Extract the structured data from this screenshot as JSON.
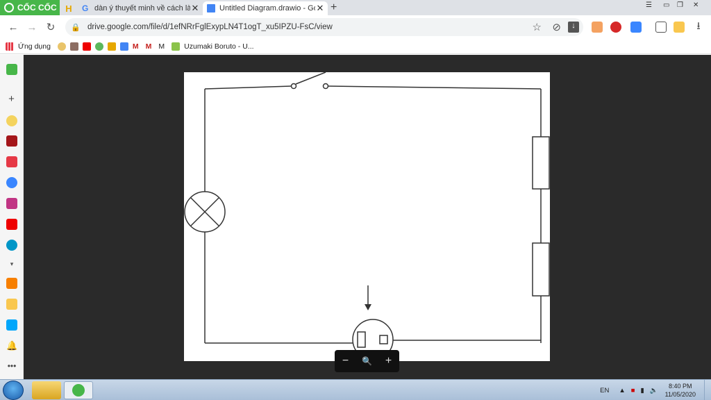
{
  "browser": {
    "brand": "CỐC CỐC",
    "tabs": [
      {
        "title": "dàn ý thuyết minh về cách làm",
        "favicon": "google-icon",
        "active": false
      },
      {
        "title": "Untitled Diagram.drawio - Go",
        "favicon": "google-docs-icon",
        "active": true
      }
    ],
    "url": "drive.google.com/file/d/1efNRrFglExypLN4T1ogT_xu5IPZU-FsC/view",
    "bookmarks": [
      {
        "label": "Ứng dụng",
        "icon": "apps-grid-icon"
      },
      {
        "label": "",
        "icon": "bookmark-1-icon"
      },
      {
        "label": "",
        "icon": "bookmark-2-icon"
      },
      {
        "label": "",
        "icon": "youtube-icon"
      },
      {
        "label": "",
        "icon": "bookmark-4-icon"
      },
      {
        "label": "",
        "icon": "h-icon"
      },
      {
        "label": "",
        "icon": "translate-icon"
      },
      {
        "label": "M",
        "icon": "gmail-icon"
      },
      {
        "label": "M",
        "icon": "gmail-icon-2"
      },
      {
        "label": "M",
        "icon": ""
      },
      {
        "label": "Uzumaki Boruto - U...",
        "icon": "image-icon"
      }
    ]
  },
  "viewer": {
    "zoom_controls": {
      "zoom_out": "−",
      "zoom": "🔍",
      "zoom_in": "+"
    }
  },
  "taskbar": {
    "language": "EN",
    "time": "8:40 PM",
    "date": "11/05/2020"
  },
  "colors": {
    "brand_green": "#47b649",
    "viewer_bg": "#2a2a2a",
    "taskbar": "#a9bfd8"
  }
}
